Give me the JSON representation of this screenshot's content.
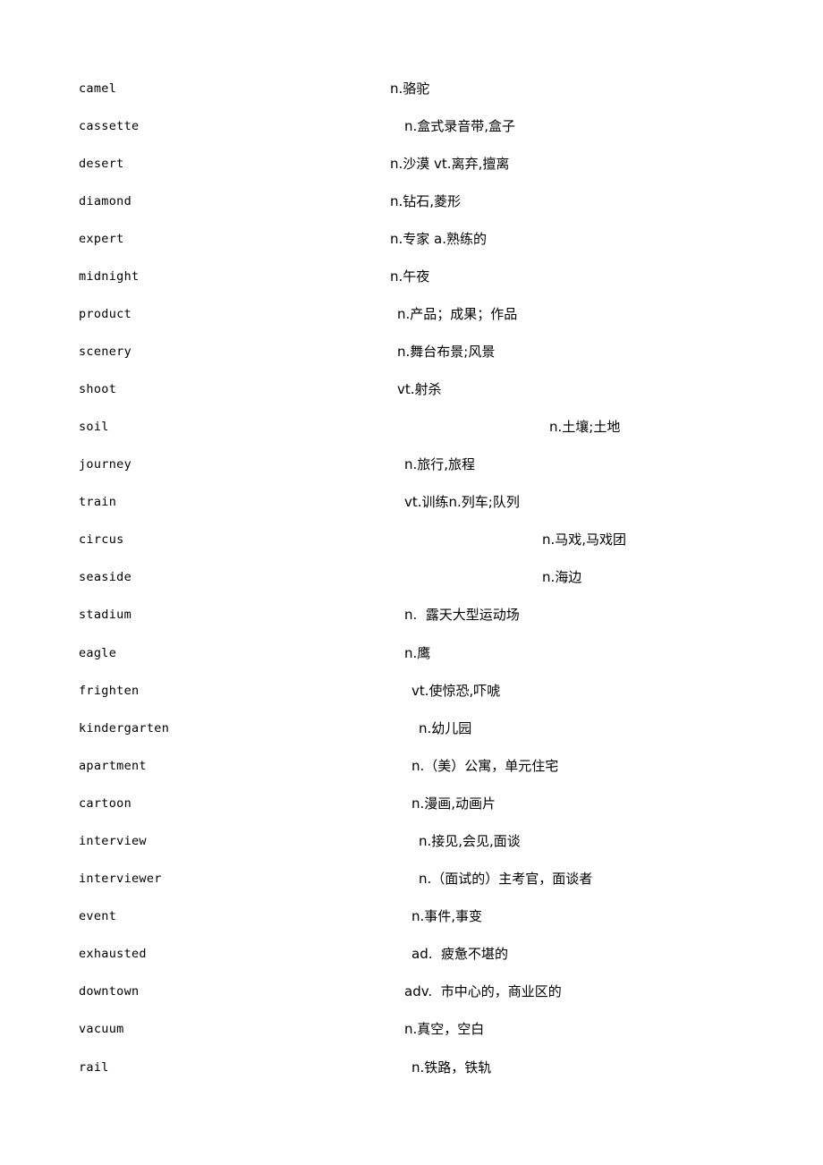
{
  "document": {
    "entries": [
      {
        "word": "camel",
        "definition": "n.骆驼"
      },
      {
        "word": "cassette",
        "definition": "n.盒式录音带,盒子"
      },
      {
        "word": "desert",
        "definition": "n.沙漠 vt.离弃,擅离"
      },
      {
        "word": "diamond",
        "definition": "n.钻石,菱形"
      },
      {
        "word": "expert",
        "definition": "n.专家 a.熟练的"
      },
      {
        "word": "midnight",
        "definition": "n.午夜"
      },
      {
        "word": "product",
        "definition": "n.产品；成果；作品"
      },
      {
        "word": "scenery",
        "definition": "n.舞台布景;风景"
      },
      {
        "word": "shoot",
        "definition": "vt.射杀"
      },
      {
        "word": "soil",
        "definition": "n.土壤;土地"
      },
      {
        "word": "journey",
        "definition": "n.旅行,旅程"
      },
      {
        "word": "train",
        "definition": "vt.训练n.列车;队列"
      },
      {
        "word": "circus",
        "definition": "n.马戏,马戏团"
      },
      {
        "word": "seaside",
        "definition": "n.海边"
      },
      {
        "word": "stadium",
        "definition": "n.  露天大型运动场"
      },
      {
        "word": "eagle",
        "definition": "n.鹰"
      },
      {
        "word": "frighten",
        "definition": "vt.使惊恐,吓唬"
      },
      {
        "word": "kindergarten",
        "definition": "n.幼儿园"
      },
      {
        "word": "apartment",
        "definition": "n.（美）公寓，单元住宅"
      },
      {
        "word": "cartoon",
        "definition": "n.漫画,动画片"
      },
      {
        "word": "interview",
        "definition": "n.接见,会见,面谈"
      },
      {
        "word": "interviewer",
        "definition": "n.（面试的）主考官，面谈者"
      },
      {
        "word": "event",
        "definition": "n.事件,事变"
      },
      {
        "word": "exhausted",
        "definition": "ad.  疲惫不堪的"
      },
      {
        "word": "downtown",
        "definition": "adv.  市中心的，商业区的"
      },
      {
        "word": "vacuum",
        "definition": "n.真空，空白"
      },
      {
        "word": "rail",
        "definition": "n.铁路，铁轨"
      }
    ]
  }
}
